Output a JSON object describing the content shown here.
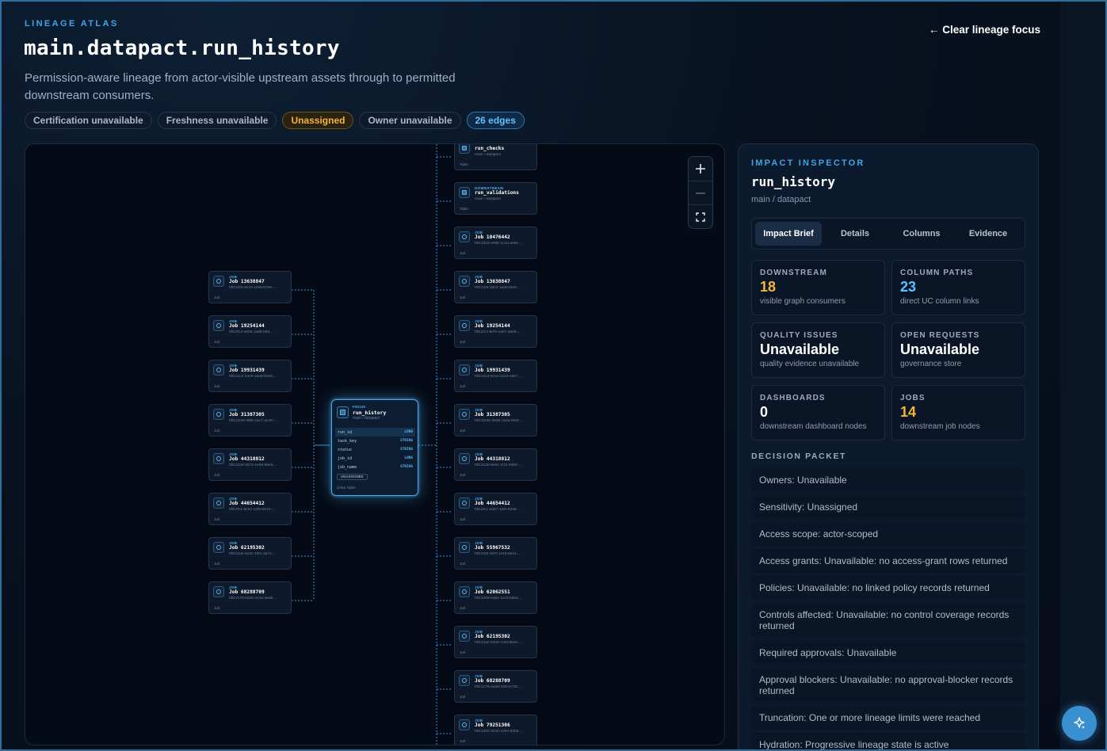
{
  "header": {
    "eyebrow": "LINEAGE ATLAS",
    "title": "main.datapact.run_history",
    "subtitle": "Permission-aware lineage from actor-visible upstream assets through to permitted downstream consumers.",
    "clear_link": "← Clear lineage focus"
  },
  "chips": [
    {
      "label": "Certification unavailable",
      "tone": "neutral"
    },
    {
      "label": "Freshness unavailable",
      "tone": "neutral"
    },
    {
      "label": "Unassigned",
      "tone": "warn"
    },
    {
      "label": "Owner unavailable",
      "tone": "neutral"
    },
    {
      "label": "26 edges",
      "tone": "info"
    }
  ],
  "graph": {
    "zoom_in_icon": "plus-icon",
    "zoom_out_icon": "minus-icon",
    "fit_icon": "fit-view-icon",
    "upstream": [
      {
        "kind": "JOB",
        "name": "Job 13638847",
        "sub": "0ff131f5-0e10-1e59-b79e-…",
        "foot": "Job"
      },
      {
        "kind": "JOB",
        "name": "Job 19254144",
        "sub": "0ff13fc3-e825-1ad6-b53…",
        "foot": "Job"
      },
      {
        "kind": "JOB",
        "name": "Job 19931439",
        "sub": "0ff131c2-44c9-15dd-84e8…",
        "foot": "Job"
      },
      {
        "kind": "JOB",
        "name": "Job 31387305",
        "sub": "0ff131f48-f685-15c7-ac49-…",
        "foot": "Job"
      },
      {
        "kind": "JOB",
        "name": "Job 44318812",
        "sub": "0ff131d0-057a-1e68-86e6…",
        "foot": "Job"
      },
      {
        "kind": "JOB",
        "name": "Job 44654412",
        "sub": "0ff12fc1-8c63-1df5-b513-…",
        "foot": "Job"
      },
      {
        "kind": "JOB",
        "name": "Job 62195302",
        "sub": "0ff131de-524c-1f01-ab71-…",
        "foot": "Job"
      },
      {
        "kind": "JOB",
        "name": "Job 68288709",
        "sub": "0ff13179-b52b-1e1e-aed5…",
        "foot": "Job"
      }
    ],
    "focus": {
      "kind": "FOCUS",
      "name": "run_history",
      "sub": "main / datapact",
      "columns": [
        {
          "name": "run_id",
          "type": "LONG",
          "selected": true
        },
        {
          "name": "task_key",
          "type": "STRING",
          "selected": false
        },
        {
          "name": "status",
          "type": "STRING",
          "selected": false
        },
        {
          "name": "job_id",
          "type": "LONG",
          "selected": false
        },
        {
          "name": "job_name",
          "type": "STRING",
          "selected": false
        }
      ],
      "badge": "UNASSIGNED",
      "foot": "Delta Table"
    },
    "downstream": [
      {
        "kind": "",
        "name": "run_checks",
        "sub": "main / datapact",
        "foot": "Table",
        "table": true
      },
      {
        "kind": "DOWNSTREAM",
        "name": "run_validations",
        "sub": "main / datapact",
        "foot": "Table",
        "table": true
      },
      {
        "kind": "JOB",
        "name": "Job 10476442",
        "sub": "0ff13203-e69b-1c1d-ae8e…",
        "foot": "Job"
      },
      {
        "kind": "JOB",
        "name": "Job 13638847",
        "sub": "0ff131f5-25c2-1ad0-bfe0-…",
        "foot": "Job"
      },
      {
        "kind": "JOB",
        "name": "Job 19254144",
        "sub": "0ff12fc3-fb79-1a07-ab69-…",
        "foot": "Job"
      },
      {
        "kind": "JOB",
        "name": "Job 19931439",
        "sub": "0ff131c3-5cca-1534-a9e7…",
        "foot": "Job"
      },
      {
        "kind": "JOB",
        "name": "Job 31387305",
        "sub": "0ff131f48-3838-1e2a-9fd0-…",
        "foot": "Job"
      },
      {
        "kind": "JOB",
        "name": "Job 44318812",
        "sub": "0ff131d0-5eb1-1f11-9353-…",
        "foot": "Job"
      },
      {
        "kind": "JOB",
        "name": "Job 44654412",
        "sub": "0ff12fc1-a457-1efe-82d5-…",
        "foot": "Job"
      },
      {
        "kind": "JOB",
        "name": "Job 55967532",
        "sub": "0ff131fb-287f-1419-8641-…",
        "foot": "Job"
      },
      {
        "kind": "JOB",
        "name": "Job 62062551",
        "sub": "0ff13209-ea54-11c9-b5b5…",
        "foot": "Job"
      },
      {
        "kind": "JOB",
        "name": "Job 62195302",
        "sub": "0ff131de-6349-14fd-864e-…",
        "foot": "Job"
      },
      {
        "kind": "JOB",
        "name": "Job 68288709",
        "sub": "0ff13179-aa38-19fb-b732-…",
        "foot": "Job"
      },
      {
        "kind": "JOB",
        "name": "Job 79251306",
        "sub": "0ff13202-2b42-1e94-8308…",
        "foot": "Job"
      }
    ]
  },
  "inspector": {
    "eyebrow": "IMPACT INSPECTOR",
    "title": "run_history",
    "sub": "main / datapact",
    "tabs": [
      {
        "label": "Impact Brief",
        "active": true
      },
      {
        "label": "Details",
        "active": false
      },
      {
        "label": "Columns",
        "active": false
      },
      {
        "label": "Evidence",
        "active": false
      }
    ],
    "stats": [
      {
        "label": "DOWNSTREAM",
        "value": "18",
        "note": "visible graph consumers",
        "tone": "orange"
      },
      {
        "label": "COLUMN PATHS",
        "value": "23",
        "note": "direct UC column links",
        "tone": "blue"
      },
      {
        "label": "QUALITY ISSUES",
        "value": "Unavailable",
        "note": "quality evidence unavailable",
        "tone": "white"
      },
      {
        "label": "OPEN REQUESTS",
        "value": "Unavailable",
        "note": "governance store",
        "tone": "white"
      },
      {
        "label": "DASHBOARDS",
        "value": "0",
        "note": "downstream dashboard nodes",
        "tone": "white"
      },
      {
        "label": "JOBS",
        "value": "14",
        "note": "downstream job nodes",
        "tone": "orange"
      }
    ],
    "packet_heading": "DECISION PACKET",
    "packet": [
      "Owners: Unavailable",
      "Sensitivity: Unassigned",
      "Access scope: actor-scoped",
      "Access grants: Unavailable: no access-grant rows returned",
      "Policies: Unavailable: no linked policy records returned",
      "Controls affected: Unavailable: no control coverage records returned",
      "Required approvals: Unavailable",
      "Approval blockers: Unavailable: no approval-blocker records returned",
      "Truncation: One or more lineage limits were reached",
      "Hydration: Progressive lineage state is active"
    ]
  },
  "assistant_icon": "sparkle-icon"
}
